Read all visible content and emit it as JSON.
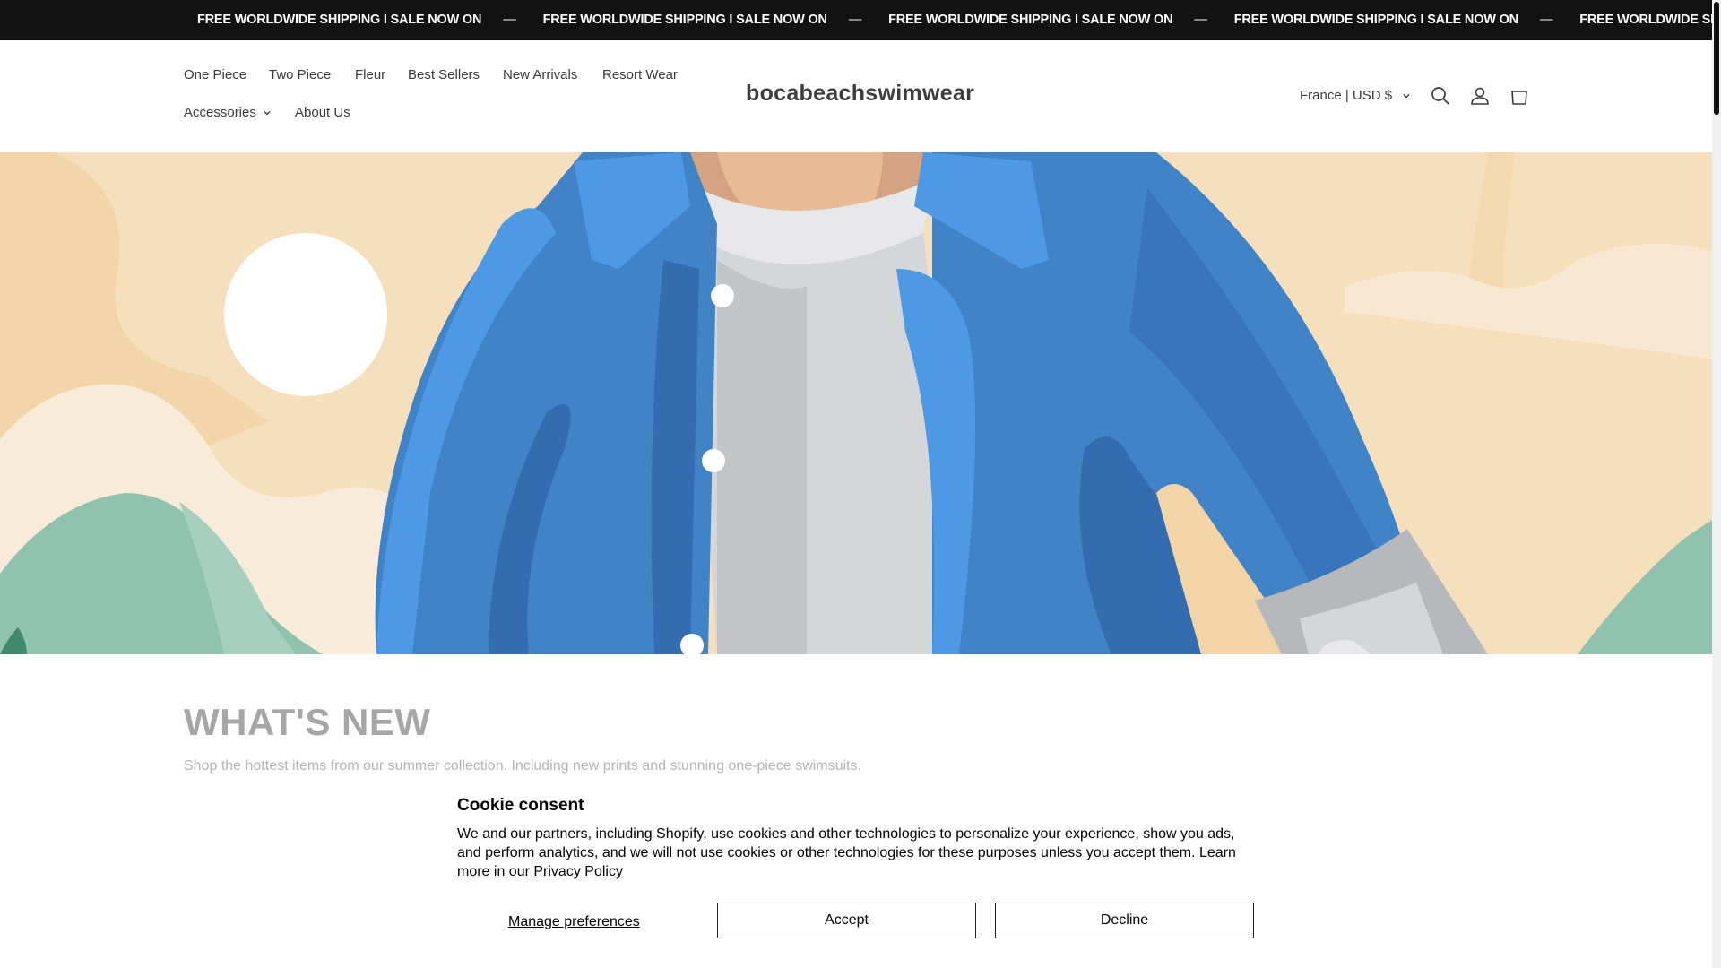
{
  "announcement": {
    "text": "FREE WORLDWIDE SHIPPING I SALE NOW ON",
    "separator": "—",
    "repeats": [
      "FREE WORLDWIDE SHIPPING I SALE NOW ON",
      "FREE WORLDWIDE SHIPPING I SALE NOW ON",
      "FREE WORLDWIDE SHIPPING I SALE NOW ON",
      "FREE WORLDWIDE SHIPPING I SALE NOW ON",
      "FREE WORLDWIDE SHIPPING I SALE NOW ON"
    ]
  },
  "header": {
    "logo": "bocabeachswimwear",
    "nav": [
      {
        "label": "One Piece"
      },
      {
        "label": "Two Piece"
      },
      {
        "label": "Fleur"
      },
      {
        "label": "Best Sellers"
      },
      {
        "label": "New Arrivals"
      },
      {
        "label": "Resort Wear"
      },
      {
        "label": "Accessories"
      },
      {
        "label": "About Us"
      }
    ],
    "locale": "France | USD $",
    "icons": [
      "search-icon",
      "account-icon",
      "cart-icon"
    ]
  },
  "section": {
    "title": "WHAT'S NEW",
    "description": "Shop the hottest items from our summer collection. Including new prints and stunning one-piece swimsuits."
  },
  "cookie": {
    "title": "Cookie consent",
    "body": "We and our partners, including Shopify, use cookies and other technologies to personalize your experience, show you ads, and perform analytics, and we will not use cookies or other technologies for these purposes unless you accept them. Learn more in our",
    "link": "Privacy Policy",
    "manage": "Manage preferences",
    "accept": "Accept",
    "decline": "Decline"
  },
  "colors": {
    "announcement_bg": "#121212",
    "jacket_blue": "#4083c7",
    "sky": "#f5dfbd",
    "hills_green": "#8fc3ad"
  }
}
